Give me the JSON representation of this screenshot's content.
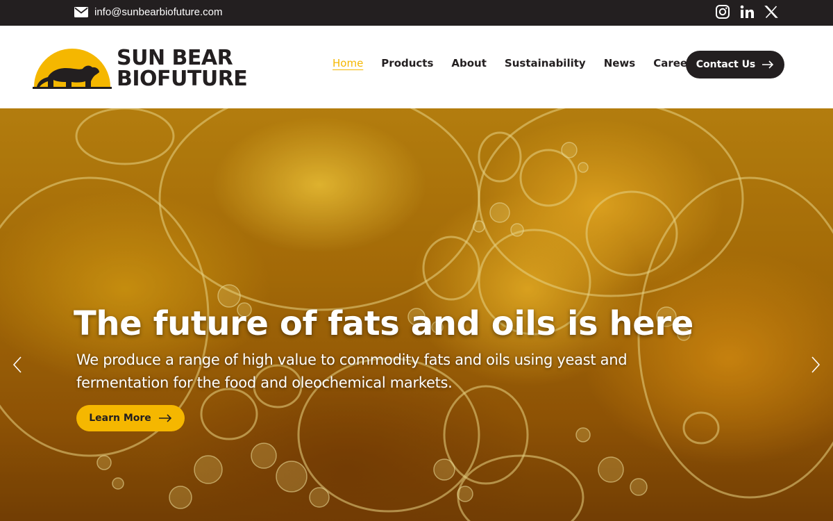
{
  "topbar": {
    "email": "info@sunbearbiofuture.com",
    "email_icon": "mail-icon",
    "socials": [
      {
        "name": "instagram-icon"
      },
      {
        "name": "linkedin-icon",
        "text": "in"
      },
      {
        "name": "x-icon"
      }
    ]
  },
  "brand": {
    "line1": "SUN BEAR",
    "line2": "BIOFUTURE",
    "logo_icon": "sun-bear-logo-icon",
    "accent": "#f5b700",
    "dark": "#231f20"
  },
  "nav": {
    "items": [
      "Home",
      "Products",
      "About",
      "Sustainability",
      "News",
      "Careers"
    ],
    "active": "Home",
    "contact_label": "Contact Us"
  },
  "hero": {
    "title": "The future of fats and oils is here",
    "subtitle": "We produce a range of high value to commodity fats and oils using yeast and fermentation for the food and oleochemical markets.",
    "cta_label": "Learn More",
    "prev_icon": "chevron-left-icon",
    "next_icon": "chevron-right-icon"
  }
}
